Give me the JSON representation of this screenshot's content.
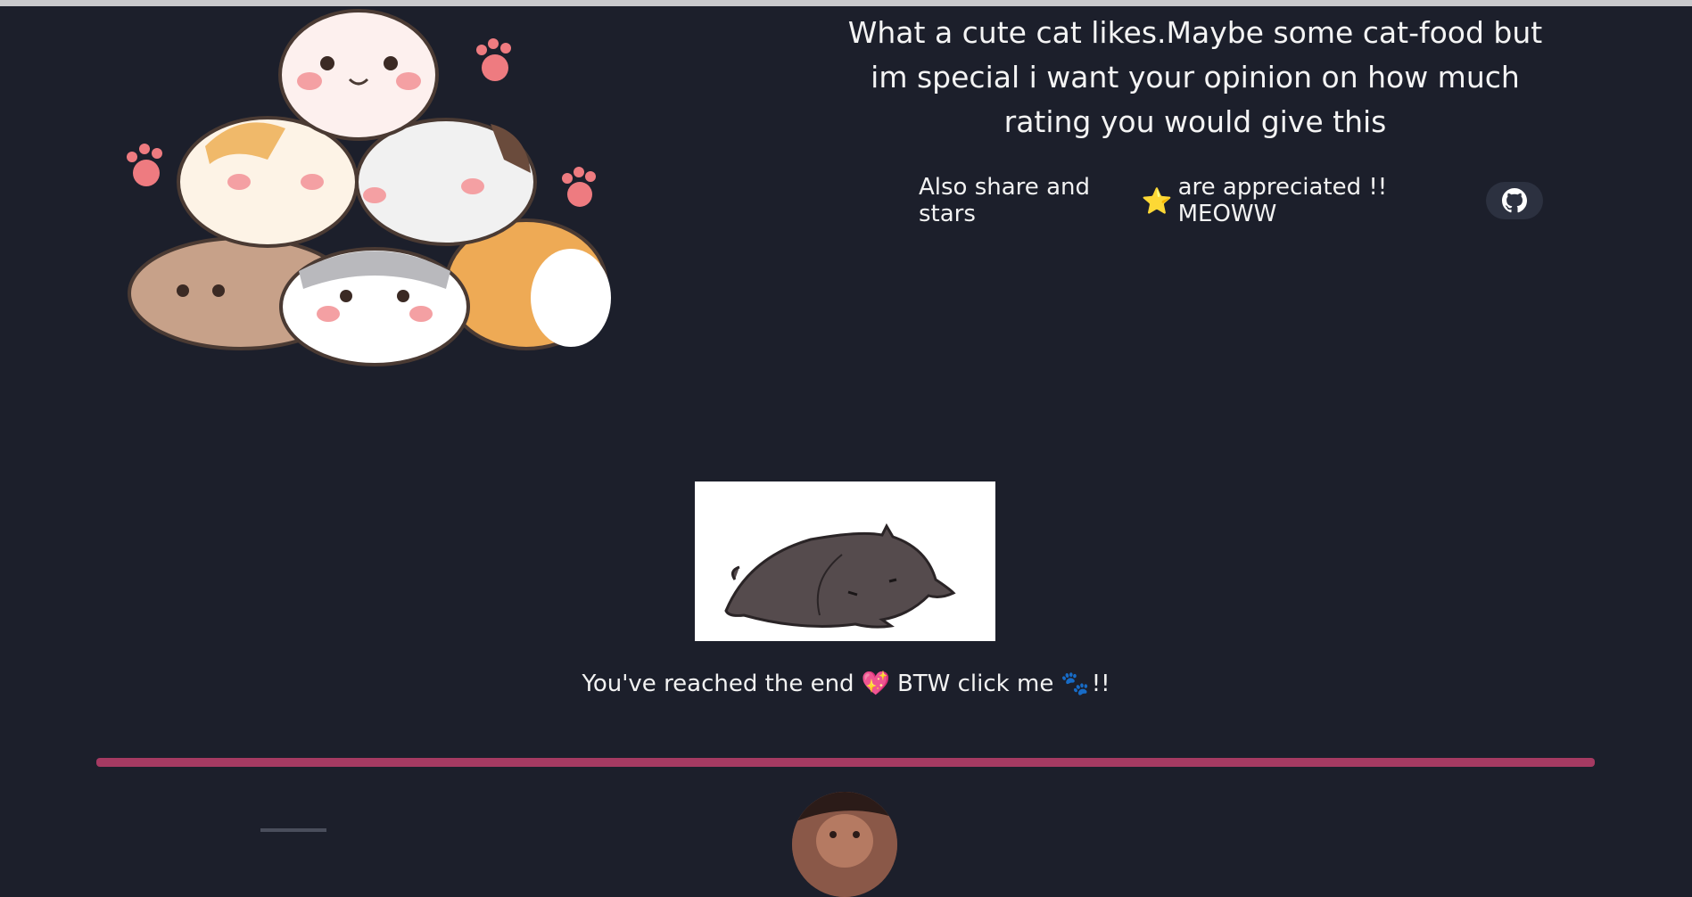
{
  "headline": "What a cute cat likes.Maybe some cat-food but im special i want your opinion on how much rating you would give this",
  "share": {
    "text_before": "Also share and stars",
    "star_icon": "⭐",
    "text_after": "are appreciated !! MEOWW",
    "github_icon": "github-icon"
  },
  "footer": {
    "end_text": "You've reached the end",
    "heart_icon": "💖",
    "click_text": "BTW click me",
    "paw_icon": "🐾",
    "exclaim": "!!"
  },
  "colors": {
    "background": "#1c1f2b",
    "divider": "#a53a62",
    "text": "#f2f2f2"
  }
}
